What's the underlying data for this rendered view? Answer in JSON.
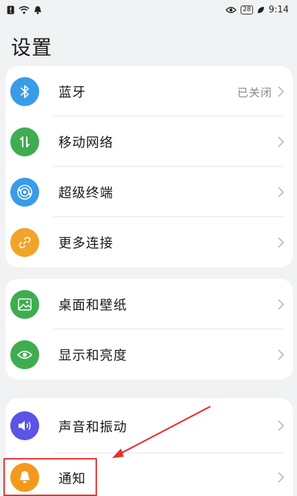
{
  "status_bar": {
    "battery": "28",
    "time": "9:14",
    "icons": [
      "alert-icon",
      "wifi-icon",
      "notification-bell-icon",
      "eye-icon",
      "battery-icon",
      "leaf-icon"
    ]
  },
  "page": {
    "title": "设置"
  },
  "groups": [
    {
      "items": [
        {
          "label": "蓝牙",
          "status": "已关闭",
          "icon": "bluetooth-icon",
          "color": "#3a9ce8"
        },
        {
          "label": "移动网络",
          "status": "",
          "icon": "mobile-network-icon",
          "color": "#3fad4f"
        },
        {
          "label": "超级终端",
          "status": "",
          "icon": "super-device-icon",
          "color": "#3a9ce8"
        },
        {
          "label": "更多连接",
          "status": "",
          "icon": "link-icon",
          "color": "#f2a32a"
        }
      ]
    },
    {
      "items": [
        {
          "label": "桌面和壁纸",
          "status": "",
          "icon": "wallpaper-icon",
          "color": "#3fad4f"
        },
        {
          "label": "显示和亮度",
          "status": "",
          "icon": "eye-icon",
          "color": "#3fad4f"
        }
      ]
    },
    {
      "items": [
        {
          "label": "声音和振动",
          "status": "",
          "icon": "speaker-icon",
          "color": "#5b54e4"
        },
        {
          "label": "通知",
          "status": "",
          "icon": "bell-icon",
          "color": "#f29a1d"
        }
      ]
    }
  ],
  "annotation": {
    "color": "#e8312e"
  }
}
